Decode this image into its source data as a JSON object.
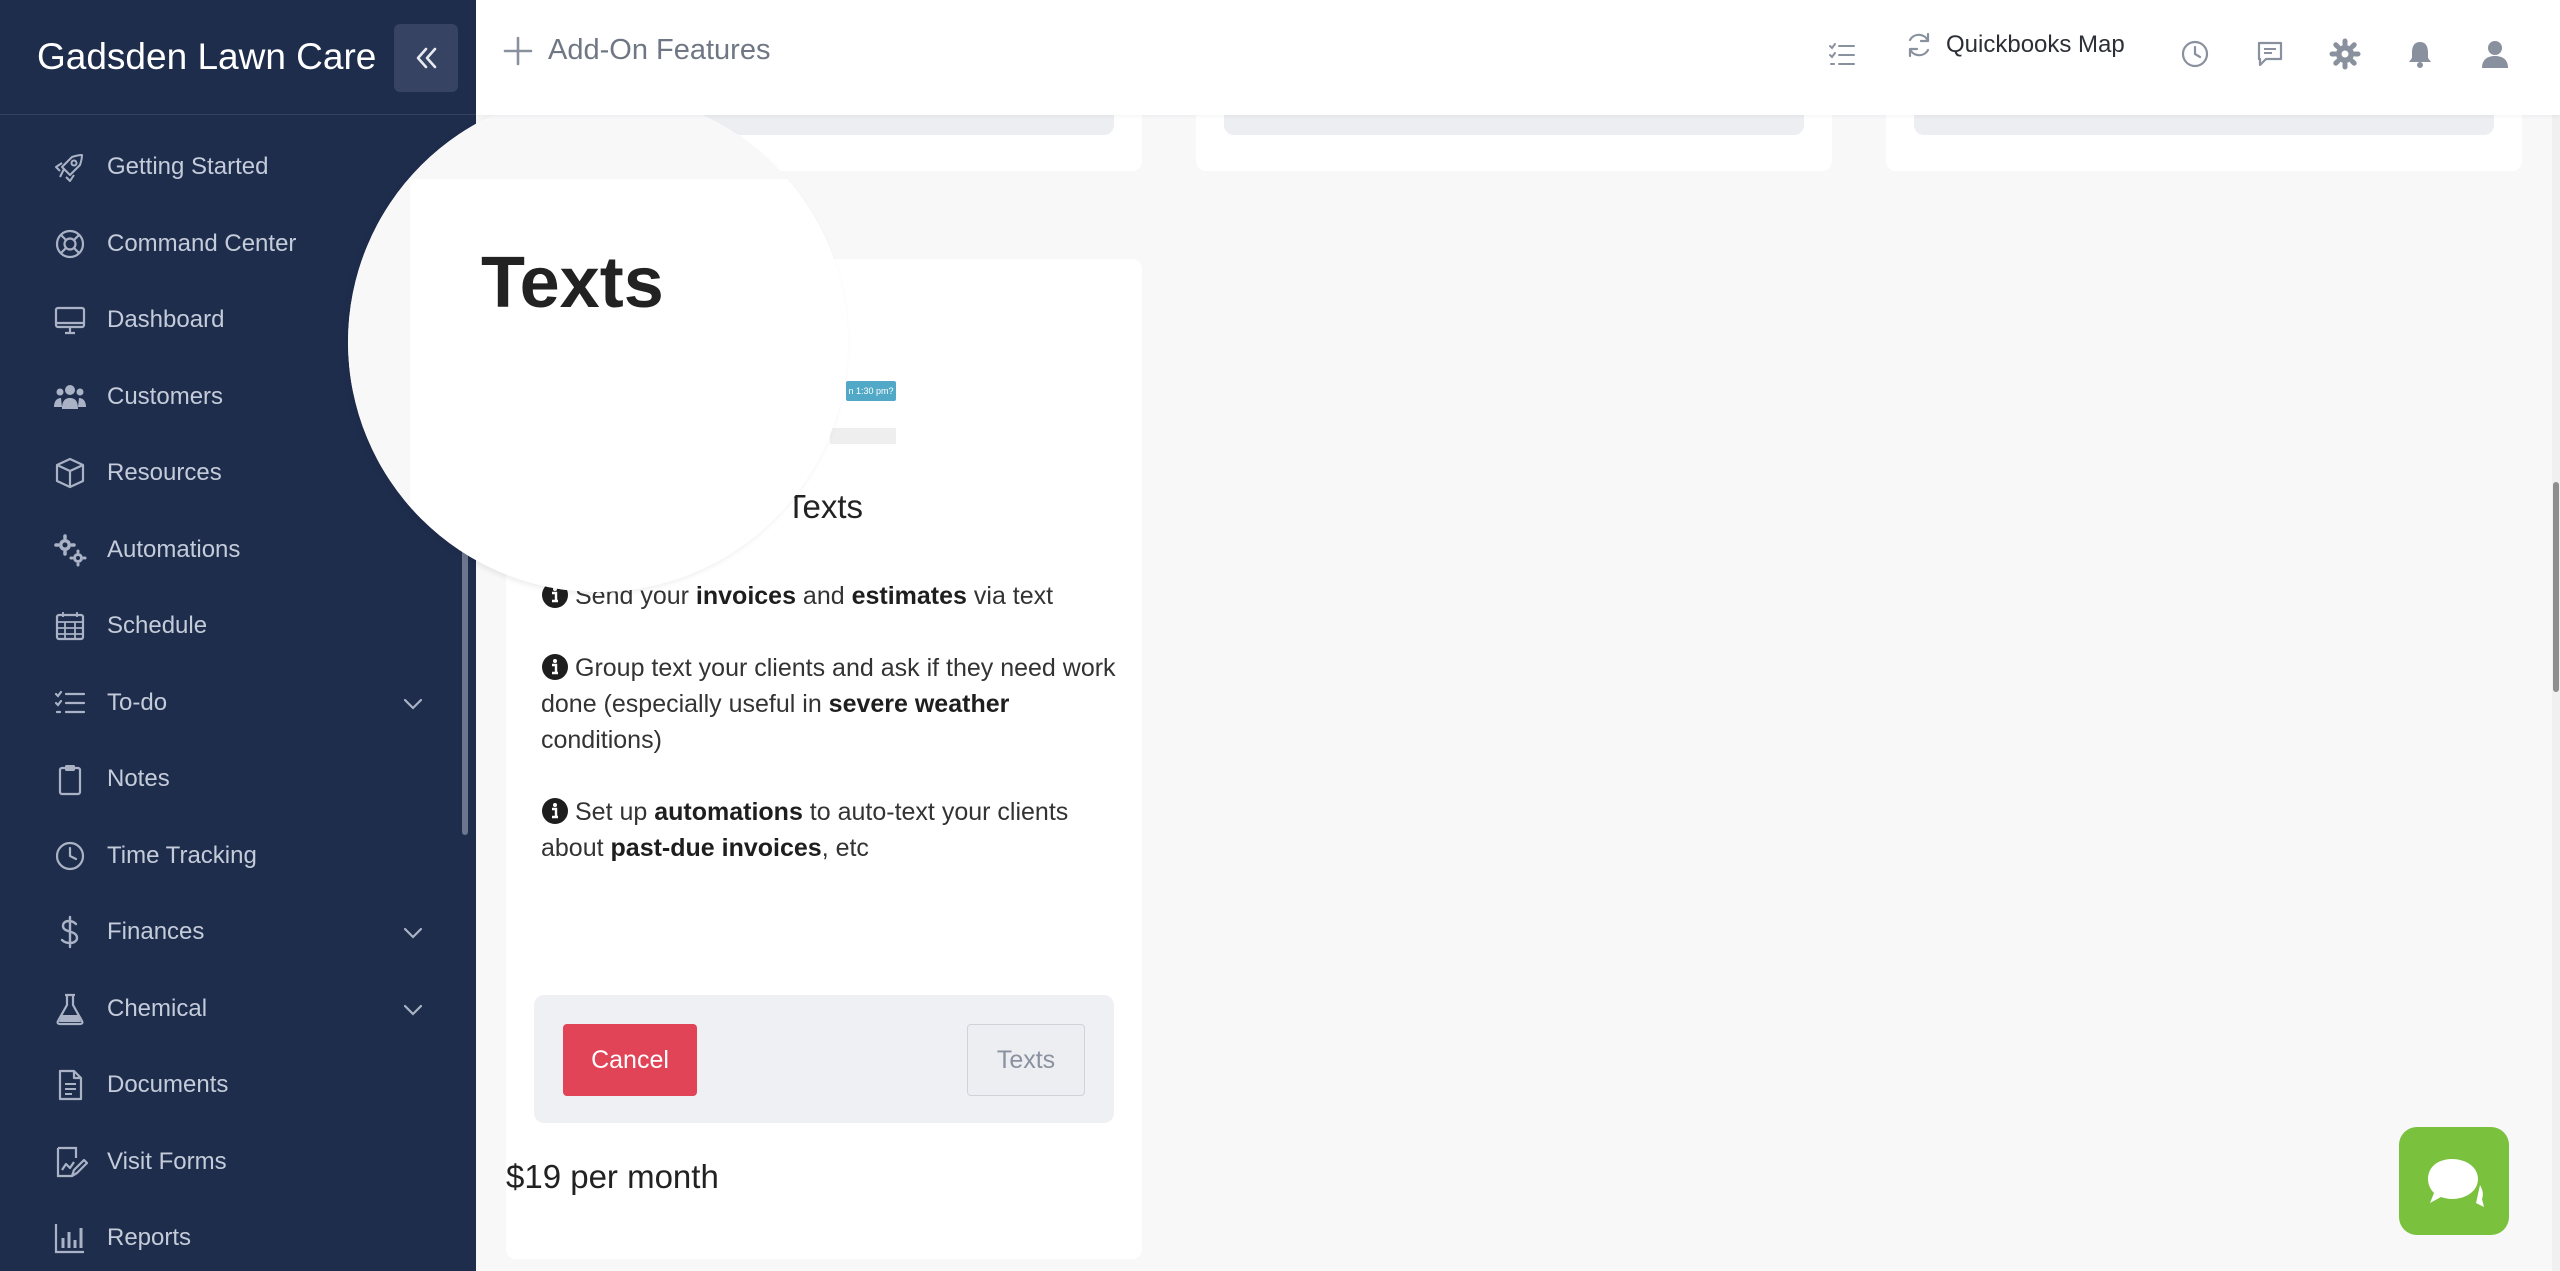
{
  "brand": {
    "name": "Gadsden Lawn Care"
  },
  "sidebar": {
    "items": [
      {
        "label": "Getting Started",
        "icon": "rocket-icon",
        "chevron": false
      },
      {
        "label": "Command Center",
        "icon": "lifebuoy-icon",
        "chevron": false
      },
      {
        "label": "Dashboard",
        "icon": "monitor-icon",
        "chevron": false
      },
      {
        "label": "Customers",
        "icon": "users-icon",
        "chevron": false
      },
      {
        "label": "Resources",
        "icon": "box-icon",
        "chevron": false
      },
      {
        "label": "Automations",
        "icon": "cogs-icon",
        "chevron": false
      },
      {
        "label": "Schedule",
        "icon": "calendar-icon",
        "chevron": false
      },
      {
        "label": "To-do",
        "icon": "checklist-icon",
        "chevron": true
      },
      {
        "label": "Notes",
        "icon": "clipboard-icon",
        "chevron": false
      },
      {
        "label": "Time Tracking",
        "icon": "clock-icon",
        "chevron": false
      },
      {
        "label": "Finances",
        "icon": "dollar-icon",
        "chevron": true
      },
      {
        "label": "Chemical",
        "icon": "flask-icon",
        "chevron": true
      },
      {
        "label": "Documents",
        "icon": "document-icon",
        "chevron": false
      },
      {
        "label": "Visit Forms",
        "icon": "form-icon",
        "chevron": false
      },
      {
        "label": "Reports",
        "icon": "bar-chart-icon",
        "chevron": false
      }
    ]
  },
  "topbar": {
    "page_title": "Add-On Features",
    "quickbooks_label": "Quickbooks Map"
  },
  "card": {
    "magnified_title": "Texts",
    "badge_text": "n 1:30 pm?",
    "title": "Texts",
    "features": [
      {
        "parts": [
          {
            "t": "Send your ",
            "b": false
          },
          {
            "t": "invoices",
            "b": true
          },
          {
            "t": " and ",
            "b": false
          },
          {
            "t": "estimates",
            "b": true
          },
          {
            "t": " via text",
            "b": false
          }
        ]
      },
      {
        "parts": [
          {
            "t": "Group text your clients and ask if they need work done (especially useful in ",
            "b": false
          },
          {
            "t": "severe weather",
            "b": true
          },
          {
            "t": " conditions)",
            "b": false
          }
        ]
      },
      {
        "parts": [
          {
            "t": "Set up ",
            "b": false
          },
          {
            "t": "automations",
            "b": true
          },
          {
            "t": " to auto-text your clients about ",
            "b": false
          },
          {
            "t": "past-due invoices",
            "b": true
          },
          {
            "t": ", etc",
            "b": false
          }
        ]
      }
    ],
    "cancel_label": "Cancel",
    "texts_label": "Texts",
    "price": "$19 per month"
  },
  "colors": {
    "sidebar_bg": "#1f2d4d",
    "cancel_red": "#e14456",
    "chat_green": "#7ac13e",
    "badge_blue": "#52a9c7"
  }
}
